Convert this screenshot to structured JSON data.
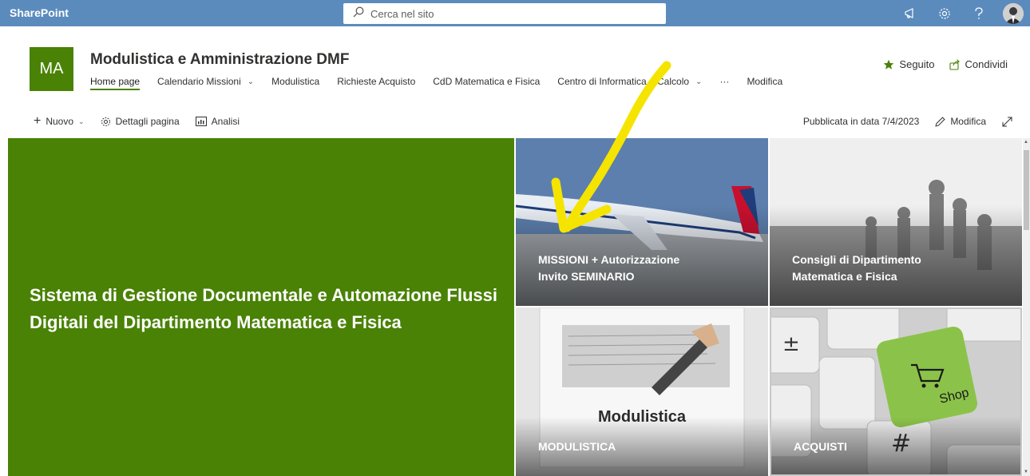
{
  "suitebar": {
    "brand": "SharePoint",
    "search_placeholder": "Cerca nel sito",
    "icons": [
      "megaphone-icon",
      "settings-icon",
      "help-icon",
      "avatar"
    ]
  },
  "site": {
    "logo": "MA",
    "title": "Modulistica e Amministrazione DMF",
    "nav": [
      {
        "label": "Home page",
        "active": true
      },
      {
        "label": "Calendario Missioni",
        "dropdown": true
      },
      {
        "label": "Modulistica"
      },
      {
        "label": "Richieste Acquisto"
      },
      {
        "label": "CdD Matematica e Fisica"
      },
      {
        "label": "Centro di Informatica e Calcolo",
        "dropdown": true
      },
      {
        "label": "···"
      },
      {
        "label": "Modifica"
      }
    ],
    "follow_label": "Seguito",
    "share_label": "Condividi"
  },
  "commandbar": {
    "new_label": "Nuovo",
    "page_details_label": "Dettagli pagina",
    "analytics_label": "Analisi",
    "published_label": "Pubblicata in data 7/4/2023",
    "edit_label": "Modifica"
  },
  "hero": {
    "main_title": "Sistema di Gestione Documentale e Automazione Flussi Digitali del Dipartimento Matematica e Fisica",
    "tiles": [
      {
        "line1": "MISSIONI + Autorizzazione",
        "line2": "Invito SEMINARIO"
      },
      {
        "line1": "Consigli di Dipartimento",
        "line2": "Matematica e Fisica"
      },
      {
        "line1": "MODULISTICA",
        "image_text": "Modulistica"
      },
      {
        "line1": "ACQUISTI",
        "image_text": "Shop"
      }
    ]
  },
  "colors": {
    "suitebar": "#5b8bbd",
    "brand_green": "#498205",
    "annotation_yellow": "#f5e400"
  }
}
